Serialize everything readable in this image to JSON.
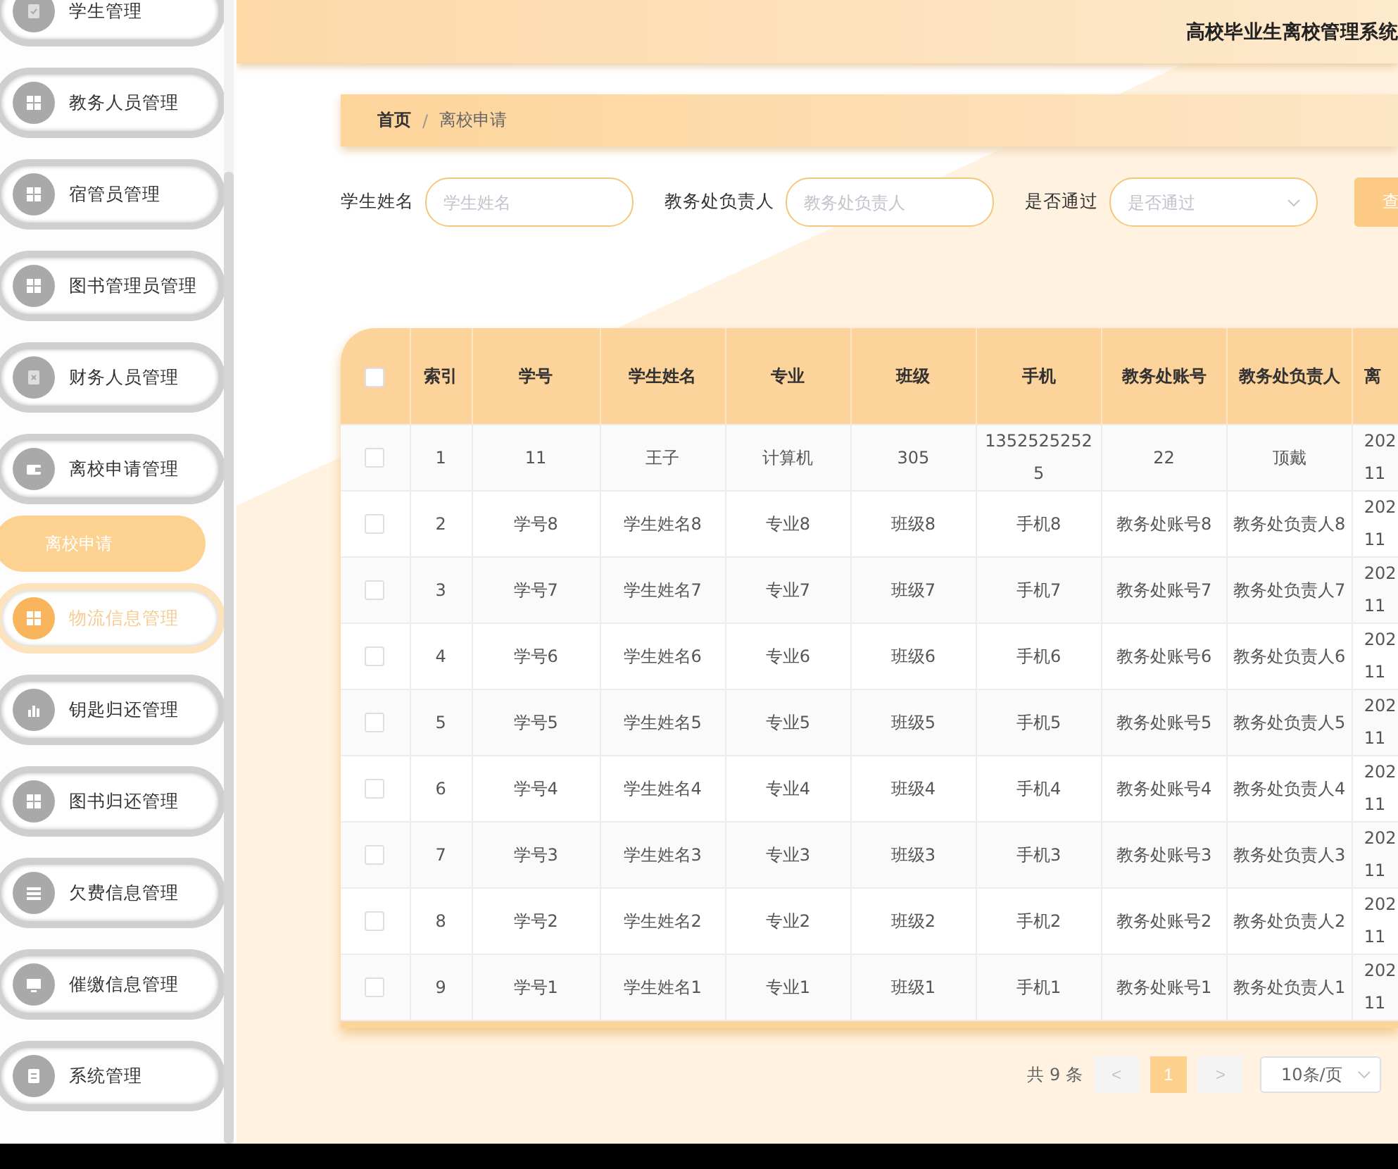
{
  "header": {
    "title": "高校毕业生离校管理系统"
  },
  "sidebar": {
    "items": [
      {
        "label": "学生管理",
        "highlighted": false
      },
      {
        "label": "教务人员管理",
        "highlighted": false
      },
      {
        "label": "宿管员管理",
        "highlighted": false
      },
      {
        "label": "图书管理员管理",
        "highlighted": false
      },
      {
        "label": "财务人员管理",
        "highlighted": false
      },
      {
        "label": "离校申请管理",
        "highlighted": false,
        "expanded": true,
        "children": [
          {
            "label": "离校申请",
            "selected": true
          }
        ]
      },
      {
        "label": "物流信息管理",
        "highlighted": true
      },
      {
        "label": "钥匙归还管理",
        "highlighted": false
      },
      {
        "label": "图书归还管理",
        "highlighted": false
      },
      {
        "label": "欠费信息管理",
        "highlighted": false
      },
      {
        "label": "催缴信息管理",
        "highlighted": false
      },
      {
        "label": "系统管理",
        "highlighted": false
      }
    ]
  },
  "breadcrumb": {
    "items": [
      "首页",
      "离校申请"
    ],
    "separator": "/"
  },
  "search": {
    "fields": [
      {
        "kind": "input",
        "label": "学生姓名",
        "placeholder": "学生姓名"
      },
      {
        "kind": "input",
        "label": "教务处负责人",
        "placeholder": "教务处负责人"
      },
      {
        "kind": "select",
        "label": "是否通过",
        "placeholder": "是否通过"
      }
    ],
    "button": "查"
  },
  "table": {
    "all_selected": false,
    "columns": [
      "索引",
      "学号",
      "学生姓名",
      "专业",
      "班级",
      "手机",
      "教务处账号",
      "教务处负责人",
      "离"
    ],
    "rows": [
      {
        "selected": false,
        "cells": [
          "1",
          "11",
          "王子",
          "计算机",
          "305",
          "13525252525",
          "22",
          "顶戴",
          "202\n11"
        ]
      },
      {
        "selected": false,
        "cells": [
          "2",
          "学号8",
          "学生姓名8",
          "专业8",
          "班级8",
          "手机8",
          "教务处账号8",
          "教务处负责人8",
          "202\n11"
        ]
      },
      {
        "selected": false,
        "cells": [
          "3",
          "学号7",
          "学生姓名7",
          "专业7",
          "班级7",
          "手机7",
          "教务处账号7",
          "教务处负责人7",
          "202\n11"
        ]
      },
      {
        "selected": false,
        "cells": [
          "4",
          "学号6",
          "学生姓名6",
          "专业6",
          "班级6",
          "手机6",
          "教务处账号6",
          "教务处负责人6",
          "202\n11"
        ]
      },
      {
        "selected": false,
        "cells": [
          "5",
          "学号5",
          "学生姓名5",
          "专业5",
          "班级5",
          "手机5",
          "教务处账号5",
          "教务处负责人5",
          "202\n11"
        ]
      },
      {
        "selected": false,
        "cells": [
          "6",
          "学号4",
          "学生姓名4",
          "专业4",
          "班级4",
          "手机4",
          "教务处账号4",
          "教务处负责人4",
          "202\n11"
        ]
      },
      {
        "selected": false,
        "cells": [
          "7",
          "学号3",
          "学生姓名3",
          "专业3",
          "班级3",
          "手机3",
          "教务处账号3",
          "教务处负责人3",
          "202\n11"
        ]
      },
      {
        "selected": false,
        "cells": [
          "8",
          "学号2",
          "学生姓名2",
          "专业2",
          "班级2",
          "手机2",
          "教务处账号2",
          "教务处负责人2",
          "202\n11"
        ]
      },
      {
        "selected": false,
        "cells": [
          "9",
          "学号1",
          "学生姓名1",
          "专业1",
          "班级1",
          "手机1",
          "教务处账号1",
          "教务处负责人1",
          "202\n11"
        ]
      }
    ]
  },
  "pagination": {
    "total": "共 9 条",
    "prev": "<",
    "pages": [
      {
        "label": "1",
        "selected": true
      }
    ],
    "next": ">",
    "page_size": "10条/页"
  }
}
